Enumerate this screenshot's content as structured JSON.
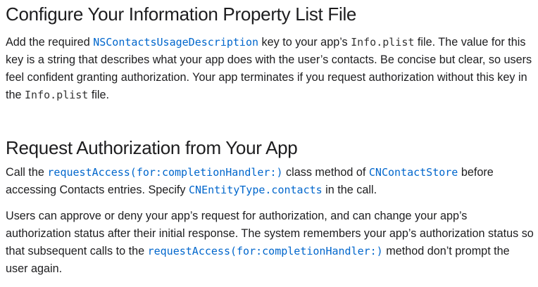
{
  "colors": {
    "text": "#1d1d1f",
    "link": "#0066cc",
    "code": "#333333",
    "background": "#ffffff"
  },
  "section1": {
    "heading": "Configure Your Information Property List File",
    "para": {
      "t1": "Add the required ",
      "link1": "NSContactsUsageDescription",
      "t2": " key to your app’s ",
      "code1": "Info.plist",
      "t3": " file. The value for this key is a string that describes what your app does with the user’s contacts. Be concise but clear, so users feel confident granting authorization. Your app terminates if you request authorization without this key in the ",
      "code2": "Info.plist",
      "t4": " file."
    }
  },
  "section2": {
    "heading": "Request Authorization from Your App",
    "para1": {
      "t1": "Call the ",
      "link1": "requestAccess(for:completionHandler:)",
      "t2": " class method of ",
      "link2": "CNContactStore",
      "t3": " before accessing Contacts entries. Specify ",
      "link3": "CNEntityType.contacts",
      "t4": " in the call."
    },
    "para2": {
      "t1": "Users can approve or deny your app’s request for authorization, and can change your app’s authorization status after their initial response. The system remembers your app’s authorization status so that subsequent calls to the ",
      "link1": "requestAccess(for:completionHandler:)",
      "t2": " method don’t prompt the user again."
    }
  }
}
